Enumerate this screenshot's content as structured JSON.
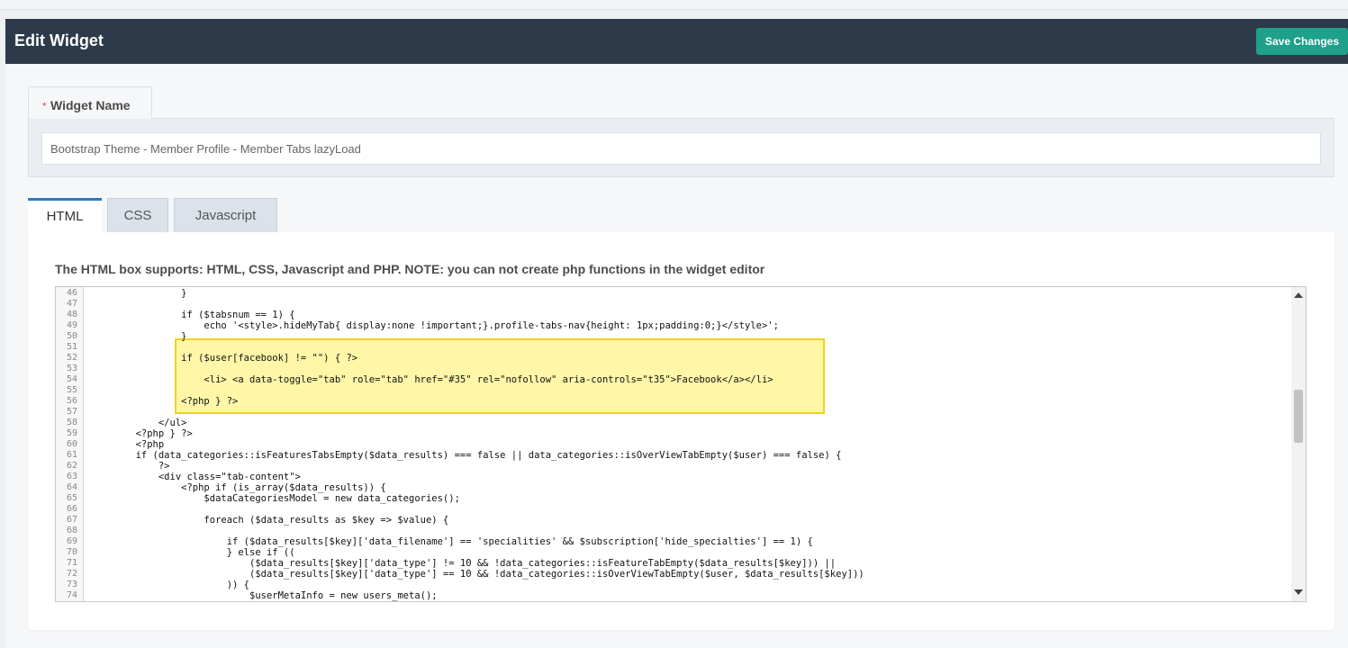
{
  "header": {
    "title": "Edit Widget",
    "save_label": "Save Changes"
  },
  "widget_name": {
    "required_mark": "*",
    "label": "Widget Name",
    "value": "Bootstrap Theme - Member Profile - Member Tabs lazyLoad"
  },
  "tabs": [
    {
      "label": "HTML",
      "active": true
    },
    {
      "label": "CSS",
      "active": false
    },
    {
      "label": "Javascript",
      "active": false
    }
  ],
  "editor": {
    "help_text": "The HTML box supports: HTML, CSS, Javascript and PHP. NOTE: you can not create php functions in the widget editor",
    "highlight_color": "#fff6a8",
    "highlight_border": "#f2d21c",
    "lines": [
      {
        "n": "46",
        "text": "                }"
      },
      {
        "n": "47",
        "text": ""
      },
      {
        "n": "48",
        "text": "                if ($tabsnum == 1) {"
      },
      {
        "n": "49",
        "text": "                    echo '<style>.hideMyTab{ display:none !important;}.profile-tabs-nav{height: 1px;padding:0;}</style>';"
      },
      {
        "n": "50",
        "text": "                }"
      },
      {
        "n": "51",
        "text": ""
      },
      {
        "n": "52",
        "text": "                if ($user[facebook] != \"\") { ?>"
      },
      {
        "n": "53",
        "text": ""
      },
      {
        "n": "54",
        "text": "                    <li> <a data-toggle=\"tab\" role=\"tab\" href=\"#35\" rel=\"nofollow\" aria-controls=\"t35\">Facebook</a></li>"
      },
      {
        "n": "55",
        "text": ""
      },
      {
        "n": "56",
        "text": "                <?php } ?>"
      },
      {
        "n": "57",
        "text": ""
      },
      {
        "n": "58",
        "text": "            </ul>"
      },
      {
        "n": "59",
        "text": "        <?php } ?>"
      },
      {
        "n": "60",
        "text": "        <?php"
      },
      {
        "n": "61",
        "text": "        if (data_categories::isFeaturesTabsEmpty($data_results) === false || data_categories::isOverViewTabEmpty($user) === false) {"
      },
      {
        "n": "62",
        "text": "            ?>"
      },
      {
        "n": "63",
        "text": "            <div class=\"tab-content\">"
      },
      {
        "n": "64",
        "text": "                <?php if (is_array($data_results)) {"
      },
      {
        "n": "65",
        "text": "                    $dataCategoriesModel = new data_categories();"
      },
      {
        "n": "66",
        "text": ""
      },
      {
        "n": "67",
        "text": "                    foreach ($data_results as $key => $value) {"
      },
      {
        "n": "68",
        "text": ""
      },
      {
        "n": "69",
        "text": "                        if ($data_results[$key]['data_filename'] == 'specialities' && $subscription['hide_specialties'] == 1) {"
      },
      {
        "n": "70",
        "text": "                        } else if (("
      },
      {
        "n": "71",
        "text": "                            ($data_results[$key]['data_type'] != 10 && !data_categories::isFeatureTabEmpty($data_results[$key])) ||"
      },
      {
        "n": "72",
        "text": "                            ($data_results[$key]['data_type'] == 10 && !data_categories::isOverViewTabEmpty($user, $data_results[$key]))"
      },
      {
        "n": "73",
        "text": "                        )) {"
      },
      {
        "n": "74",
        "text": "                            $userMetaInfo = new users_meta();"
      }
    ]
  }
}
